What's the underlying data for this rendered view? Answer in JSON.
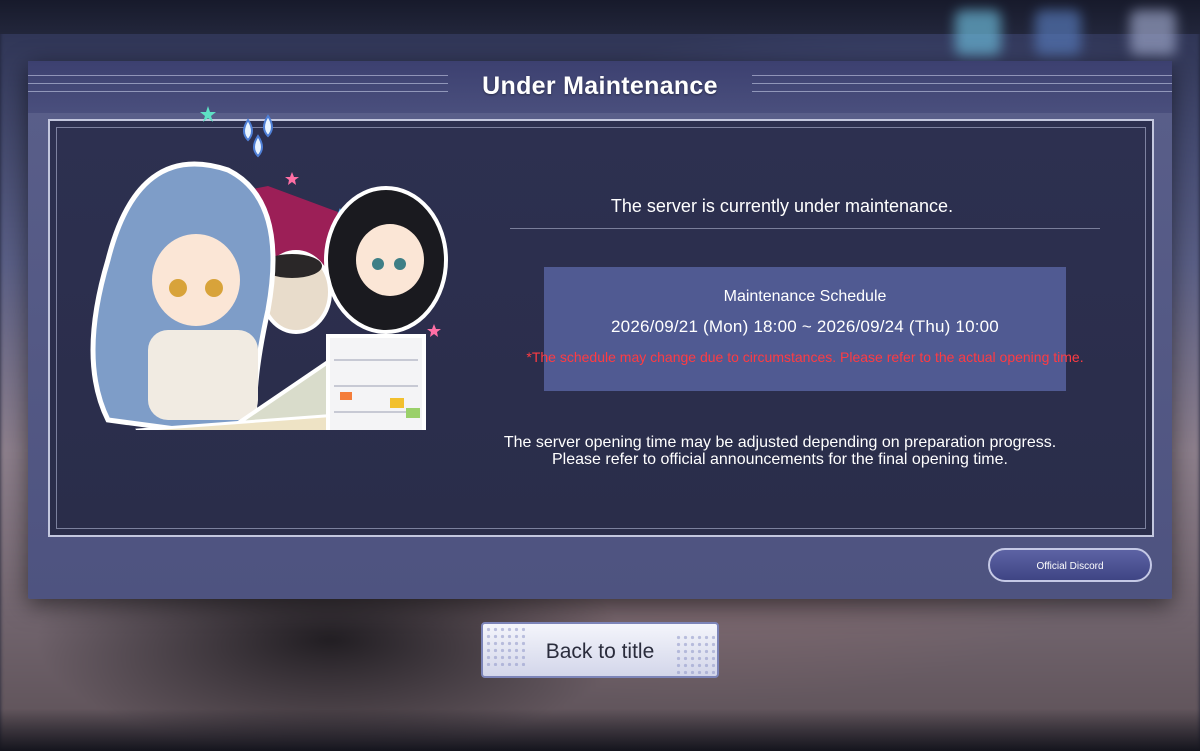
{
  "dialog": {
    "title": "Under Maintenance"
  },
  "message": {
    "main": "The server is currently under maintenance.",
    "sub_line1": "The server opening time may be adjusted depending on preparation progress.",
    "sub_line2": "Please refer to official announcements for the final opening time."
  },
  "schedule": {
    "title": "Maintenance Schedule",
    "range": "2026/09/21 (Mon) 18:00 ~ 2026/09/24 (Thu) 10:00",
    "note": "*The schedule may change due to circumstances. Please refer to the actual opening time."
  },
  "buttons": {
    "discord_label": "Official Discord",
    "back_label": "Back to title"
  },
  "illustration": {
    "icon": "maintenance-characters-illustration"
  },
  "colors": {
    "note_red": "#ff3b42",
    "schedule_box": "#505a92",
    "panel_dark": "#2d3050",
    "dialog_frame": "#5a5f8a"
  }
}
